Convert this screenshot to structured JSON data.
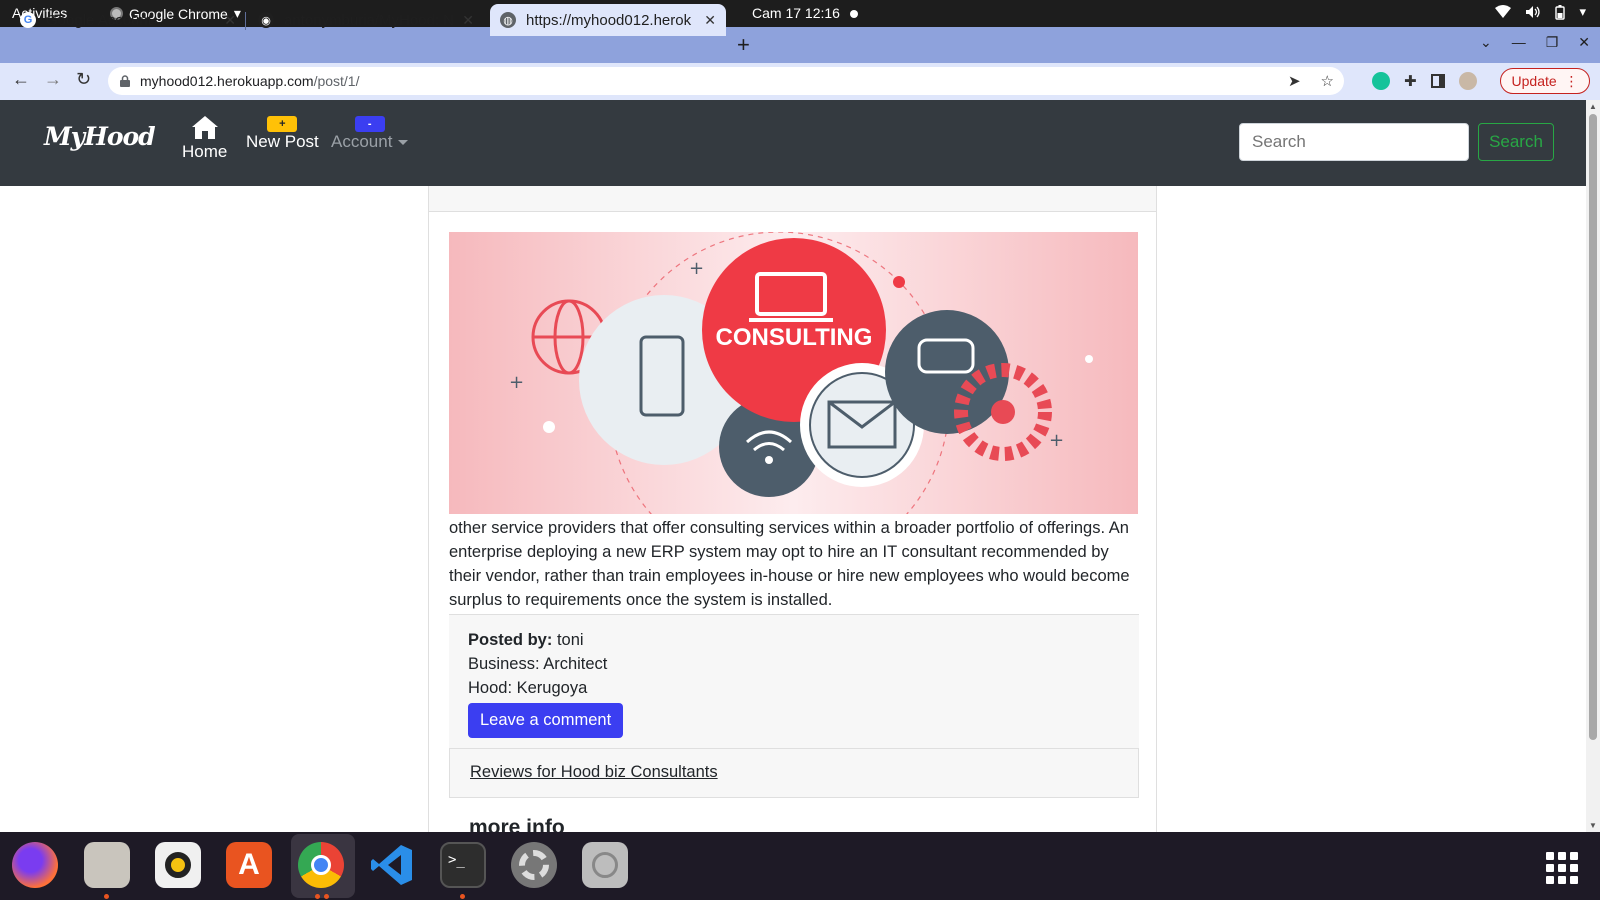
{
  "system_bar": {
    "activities": "Activities",
    "app_name": "Google Chrome",
    "clock": "Cam 17  12:16"
  },
  "browser": {
    "tabs": [
      {
        "title": "Google Account"
      },
      {
        "title": "antonymburia/MyHood: N"
      },
      {
        "title": "https://myhood012.herok"
      }
    ],
    "url": {
      "host": "myhood012.herokuapp.com",
      "path": "/post/1/"
    },
    "update_label": "Update"
  },
  "site": {
    "brand": "MyHood",
    "nav": {
      "home": "Home",
      "new_post": "New Post",
      "new_post_badge": "+",
      "account": "Account",
      "account_badge": "-"
    },
    "search": {
      "placeholder": "Search",
      "button": "Search"
    }
  },
  "post": {
    "image_text": "CONSULTING",
    "body": "other service providers that offer consulting services within a broader portfolio of offerings. An enterprise deploying a new ERP system may opt to hire an IT consultant recommended by their vendor, rather than train employees in-house or hire new employees who would become surplus to requirements once the system is installed.",
    "posted_by_label": "Posted by:",
    "posted_by": "toni",
    "business": "Business: Architect",
    "hood": "Hood: Kerugoya",
    "comment_button": "Leave a comment",
    "reviews_link": "Reviews for Hood biz Consultants",
    "more_info": "more info"
  },
  "colors": {
    "navbar": "#343a40",
    "primary": "#3b3ef1",
    "success": "#28a745",
    "warning": "#ffc107",
    "tabstrip": "#8ea2dc"
  }
}
